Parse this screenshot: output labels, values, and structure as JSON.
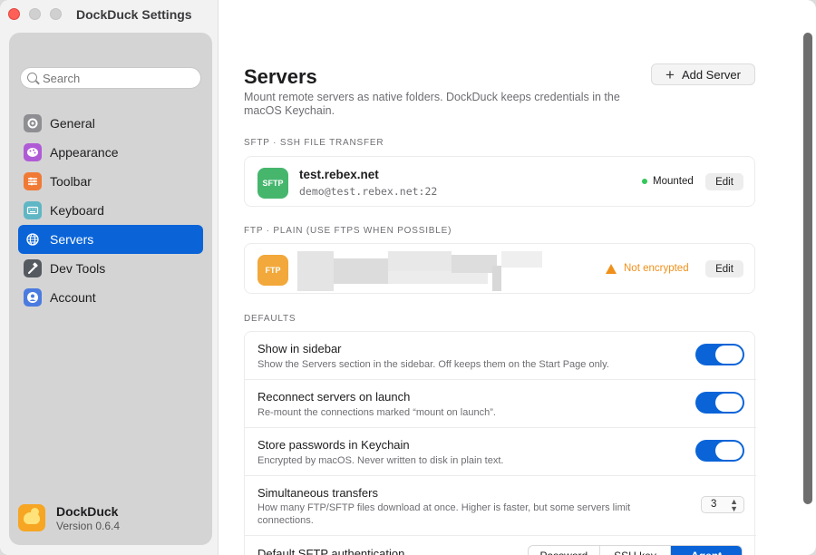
{
  "window": {
    "title": "DockDuck Settings"
  },
  "sidebar": {
    "search_placeholder": "Search",
    "items": [
      {
        "label": "General",
        "icon": "gear-icon",
        "color": "#8e8e93"
      },
      {
        "label": "Appearance",
        "icon": "palette-icon",
        "color": "#b05bd6"
      },
      {
        "label": "Toolbar",
        "icon": "sliders-icon",
        "color": "#f07a35"
      },
      {
        "label": "Keyboard",
        "icon": "keyboard-icon",
        "color": "#5fb6c4"
      },
      {
        "label": "Servers",
        "icon": "globe-icon",
        "color": "#0a64d8"
      },
      {
        "label": "Dev Tools",
        "icon": "hammer-icon",
        "color": "#555a60"
      },
      {
        "label": "Account",
        "icon": "person-icon",
        "color": "#4a7be0"
      }
    ],
    "active": "Servers",
    "brand": {
      "name": "DockDuck",
      "version": "Version 0.6.4"
    }
  },
  "main": {
    "title": "Servers",
    "description": "Mount remote servers as native folders. DockDuck keeps credentials in the macOS Keychain.",
    "add_button": "Add Server",
    "sections": [
      {
        "label": "SFTP · SSH FILE TRANSFER"
      },
      {
        "label": "FTP · PLAIN (USE FTPS WHEN POSSIBLE)"
      },
      {
        "label": "DEFAULTS"
      }
    ],
    "servers": [
      {
        "badge": "SFTP",
        "name": "test.rebex.net",
        "address": "demo@test.rebex.net:22",
        "status": "Mounted",
        "status_color": "#34c759",
        "edit": "Edit"
      },
      {
        "badge": "FTP",
        "name": "",
        "address": "",
        "status": "Not encrypted",
        "status_color": "#f0901a",
        "edit": "Edit"
      }
    ],
    "defaults": [
      {
        "title": "Show in sidebar",
        "desc": "Show the Servers section in the sidebar. Off keeps them on the Start Page only.",
        "on": true
      },
      {
        "title": "Reconnect servers on launch",
        "desc": "Re-mount the connections marked “mount on launch”.",
        "on": true
      },
      {
        "title": "Store passwords in Keychain",
        "desc": "Encrypted by macOS. Never written to disk in plain text.",
        "on": true
      },
      {
        "title": "Simultaneous transfers",
        "desc": "How many FTP/SFTP files download at once. Higher is faster, but some servers limit connections.",
        "value": "3"
      },
      {
        "title": "Default SFTP authentication",
        "options": [
          "Password",
          "SSH key",
          "Agent"
        ],
        "selected": "Agent"
      }
    ]
  }
}
